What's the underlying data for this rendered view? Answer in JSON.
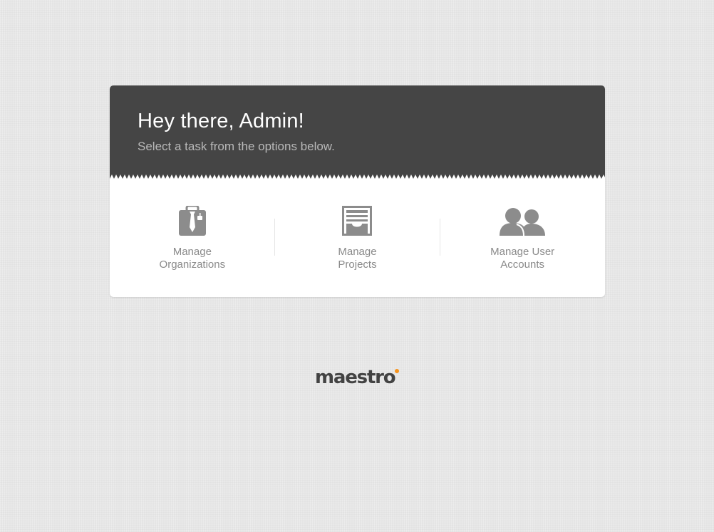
{
  "header": {
    "greeting": "Hey there, Admin!",
    "subtitle": "Select a task from the options below."
  },
  "tasks": [
    {
      "label_line1": "Manage",
      "label_line2": "Organizations",
      "icon": "briefcase-tie-icon"
    },
    {
      "label_line1": "Manage",
      "label_line2": "Projects",
      "icon": "document-tray-icon"
    },
    {
      "label_line1": "Manage User",
      "label_line2": "Accounts",
      "icon": "users-icon"
    }
  ],
  "footer": {
    "logo_text": "maestro"
  },
  "colors": {
    "header_bg": "#454545",
    "card_bg": "#ffffff",
    "page_bg": "#e6e6e6",
    "icon": "#8c8c8c",
    "label": "#8a8a8a",
    "logo": "#434343",
    "logo_accent": "#f7941d"
  }
}
